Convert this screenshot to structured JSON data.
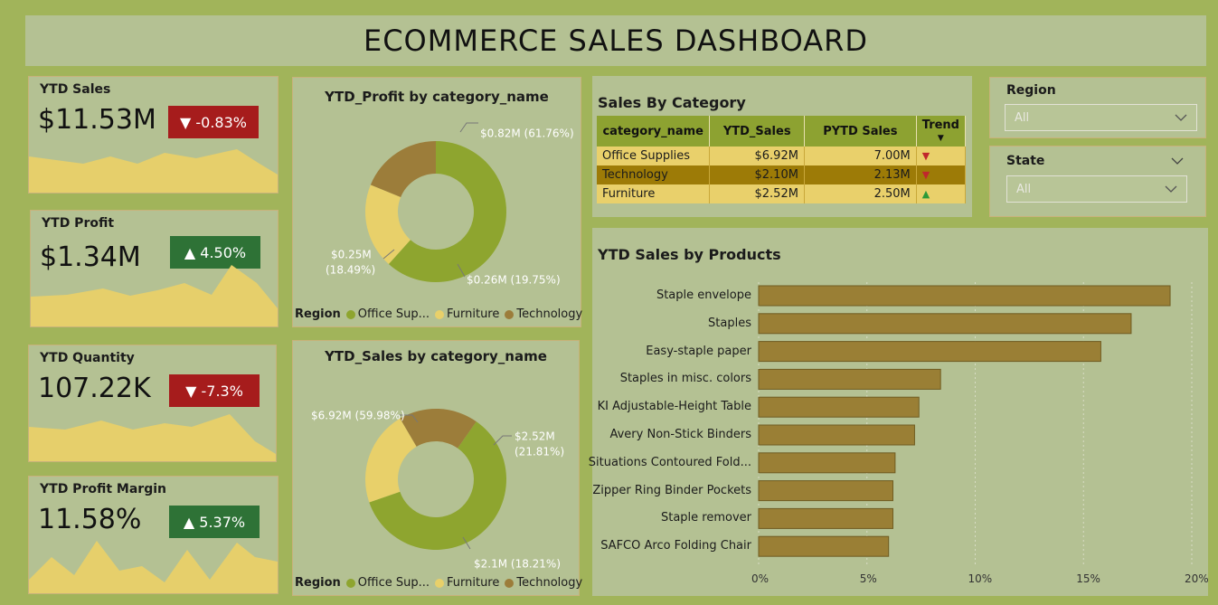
{
  "title": "ECOMMERCE SALES DASHBOARD",
  "kpis": [
    {
      "title": "YTD Sales",
      "value": "$11.53M",
      "badge": "▼ -0.83%",
      "direction": "down"
    },
    {
      "title": "YTD Profit",
      "value": "$1.34M",
      "badge": "▲ 4.50%",
      "direction": "up"
    },
    {
      "title": "YTD Quantity",
      "value": "107.22K",
      "badge": "▼ -7.3%",
      "direction": "down"
    },
    {
      "title": "YTD Profit Margin",
      "value": "11.58%",
      "badge": "▲ 5.37%",
      "direction": "up"
    }
  ],
  "donut_profit": {
    "title": "YTD_Profit by category_name",
    "labels": [
      "$0.82M (61.76%)",
      "$0.26M (19.75%)",
      "$0.25M",
      "(18.49%)"
    ],
    "legend_label": "Region",
    "legend": [
      "Office Sup...",
      "Furniture",
      "Technology"
    ]
  },
  "donut_sales": {
    "title": "YTD_Sales by category_name",
    "labels": [
      "$6.92M (59.98%)",
      "$2.52M",
      "(21.81%)",
      "$2.1M (18.21%)"
    ],
    "legend_label": "Region",
    "legend": [
      "Office Sup...",
      "Furniture",
      "Technology"
    ]
  },
  "category_table": {
    "title": "Sales By Category",
    "headers": [
      "category_name",
      "YTD_Sales",
      "PYTD Sales",
      "Trend"
    ],
    "rows": [
      {
        "name": "Office Supplies",
        "ytd": "$6.92M",
        "pytd": "7.00M",
        "trend": "down"
      },
      {
        "name": "Technology",
        "ytd": "$2.10M",
        "pytd": "2.13M",
        "trend": "down"
      },
      {
        "name": "Furniture",
        "ytd": "$2.52M",
        "pytd": "2.50M",
        "trend": "up"
      }
    ]
  },
  "slicers": {
    "region": {
      "title": "Region",
      "value": "All"
    },
    "state": {
      "title": "State",
      "value": "All"
    }
  },
  "colors": {
    "office": "#8ea52f",
    "furniture": "#e8d06a",
    "technology": "#9c7d3a",
    "bar": "#9a7f35"
  },
  "chart_data": [
    {
      "type": "pie",
      "title": "YTD_Profit by category_name",
      "categories": [
        "Office Supplies",
        "Furniture",
        "Technology"
      ],
      "values": [
        0.82,
        0.26,
        0.25
      ],
      "percent": [
        61.76,
        19.75,
        18.49
      ]
    },
    {
      "type": "pie",
      "title": "YTD_Sales by category_name",
      "categories": [
        "Office Supplies",
        "Furniture",
        "Technology"
      ],
      "values": [
        6.92,
        2.52,
        2.1
      ],
      "percent": [
        59.98,
        21.81,
        18.21
      ]
    },
    {
      "type": "bar",
      "title": "YTD Sales by Products",
      "categories": [
        "Staple envelope",
        "Staples",
        "Easy-staple paper",
        "Staples in misc. colors",
        "KI Adjustable-Height Table",
        "Avery Non-Stick Binders",
        "Situations Contoured Fold...",
        "Zipper Ring Binder Pockets",
        "Staple remover",
        "SAFCO Arco Folding Chair"
      ],
      "values": [
        19.0,
        17.2,
        15.8,
        8.4,
        7.4,
        7.2,
        6.3,
        6.2,
        6.2,
        6.0
      ],
      "xticks": [
        "0%",
        "5%",
        "10%",
        "15%",
        "20%"
      ],
      "xlim": [
        0,
        20
      ]
    }
  ]
}
